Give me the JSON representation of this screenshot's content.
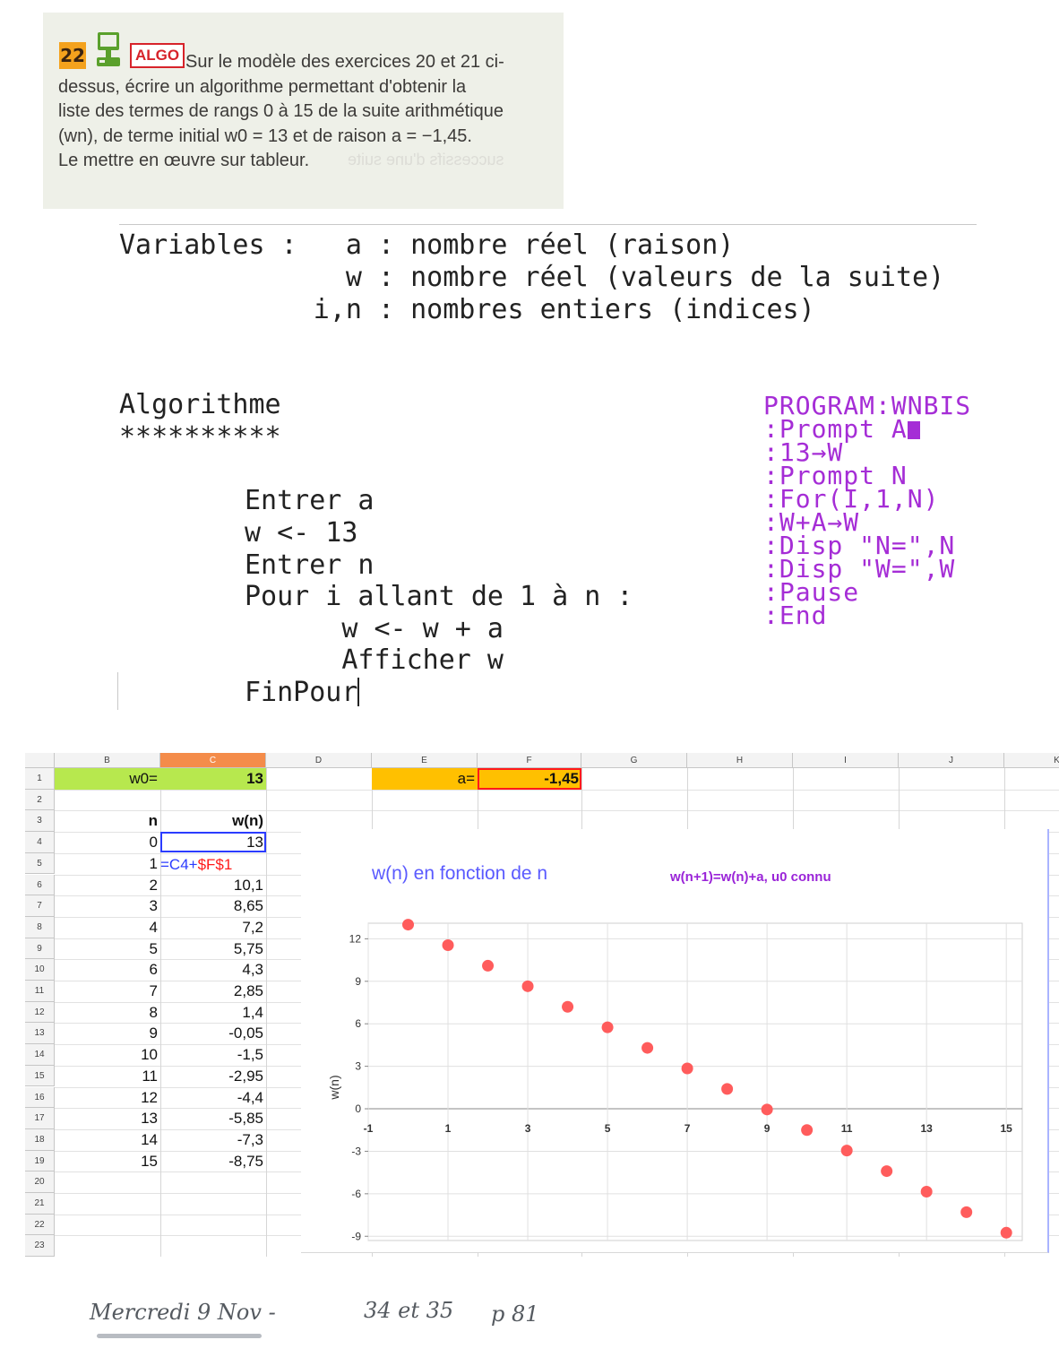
{
  "exercise": {
    "number": "22",
    "tag": "ALGO",
    "lines": [
      "Sur le modèle des exercices 20 et 21 ci-",
      "dessus, écrire un algorithme permettant d'obtenir la",
      "liste des termes de rangs 0 à 15 de la suite arithmétique",
      "(wn), de terme initial w0 = 13 et de raison a = −1,45.",
      "Le mettre en œuvre sur tableur."
    ],
    "bleed_text": "successifs d'une suite"
  },
  "algorithm": {
    "variables_lines": [
      "Variables :   a : nombre réel (raison)",
      "              w : nombre réel (valeurs de la suite)",
      "            i,n : nombres entiers (indices)"
    ],
    "title": "Algorithme",
    "stars": "**********",
    "steps": [
      "Entrer a",
      "w <- 13",
      "Entrer n",
      "Pour i allant de 1 à n :",
      "      w <- w + a",
      "      Afficher w",
      "FinPour"
    ]
  },
  "calculator": {
    "color": "#a52dd6",
    "lines": [
      "PROGRAM:WNBIS",
      ":Prompt A",
      ":13→W",
      ":Prompt N",
      ":For(I,1,N)",
      ":W+A→W",
      ":Disp \"N=\",N",
      ":Disp \"W=\",W",
      ":Pause",
      ":End"
    ]
  },
  "spreadsheet": {
    "columns": [
      "B",
      "C",
      "D",
      "E",
      "F",
      "G",
      "H",
      "I",
      "J",
      "K"
    ],
    "row_numbers": [
      "1",
      "2",
      "3",
      "4",
      "5",
      "6",
      "7",
      "8",
      "9",
      "10",
      "11",
      "12",
      "13",
      "14",
      "15",
      "16",
      "17",
      "18",
      "19",
      "20",
      "21",
      "22",
      "23"
    ],
    "w0_label": "w0=",
    "w0_value": "13",
    "a_label": "a=",
    "a_value": "-1,45",
    "n_header": "n",
    "w_header": "w(n)",
    "n_values": [
      "0",
      "1",
      "2",
      "3",
      "4",
      "5",
      "6",
      "7",
      "8",
      "9",
      "10",
      "11",
      "12",
      "13",
      "14",
      "15"
    ],
    "w_values": [
      "13",
      "",
      "10,1",
      "8,65",
      "7,2",
      "5,75",
      "4,3",
      "2,85",
      "1,4",
      "-0,05",
      "-1,5",
      "-2,95",
      "-4,4",
      "-5,85",
      "-7,3",
      "-8,75"
    ],
    "formula_prefix": "=C4+",
    "formula_ref": "$F$1",
    "colors": {
      "w0_fill": "#b7e84e",
      "a_fill": "#ffc000",
      "selected_col": "#f48c4a",
      "formula_blue": "#2b3cff",
      "formula_red": "#ff1a1a"
    }
  },
  "chart_data": {
    "type": "scatter",
    "title": "w(n) en fonction de n",
    "subtitle": "w(n+1)=w(n)+a, u0 connu",
    "xlabel": "",
    "ylabel": "w(n)",
    "x": [
      0,
      1,
      2,
      3,
      4,
      5,
      6,
      7,
      8,
      9,
      10,
      11,
      12,
      13,
      14,
      15
    ],
    "y": [
      13,
      11.55,
      10.1,
      8.65,
      7.2,
      5.75,
      4.3,
      2.85,
      1.4,
      -0.05,
      -1.5,
      -2.95,
      -4.4,
      -5.85,
      -7.3,
      -8.75
    ],
    "xlim": [
      -1,
      15.4
    ],
    "ylim": [
      -9.3,
      13.1
    ],
    "xticks": [
      "-1",
      "1",
      "3",
      "5",
      "7",
      "9",
      "11",
      "13",
      "15"
    ],
    "yticks": [
      "12",
      "9",
      "6",
      "3",
      "0",
      "-3",
      "-6",
      "-9"
    ],
    "grid": true,
    "marker_color": "#ff5c5c",
    "title_color": "#5a5aff",
    "subtitle_color": "#9a24d8"
  },
  "handwritten": {
    "date": "Mercredi 9 Nov -",
    "homework": "34 et 35",
    "page": "p 81"
  }
}
